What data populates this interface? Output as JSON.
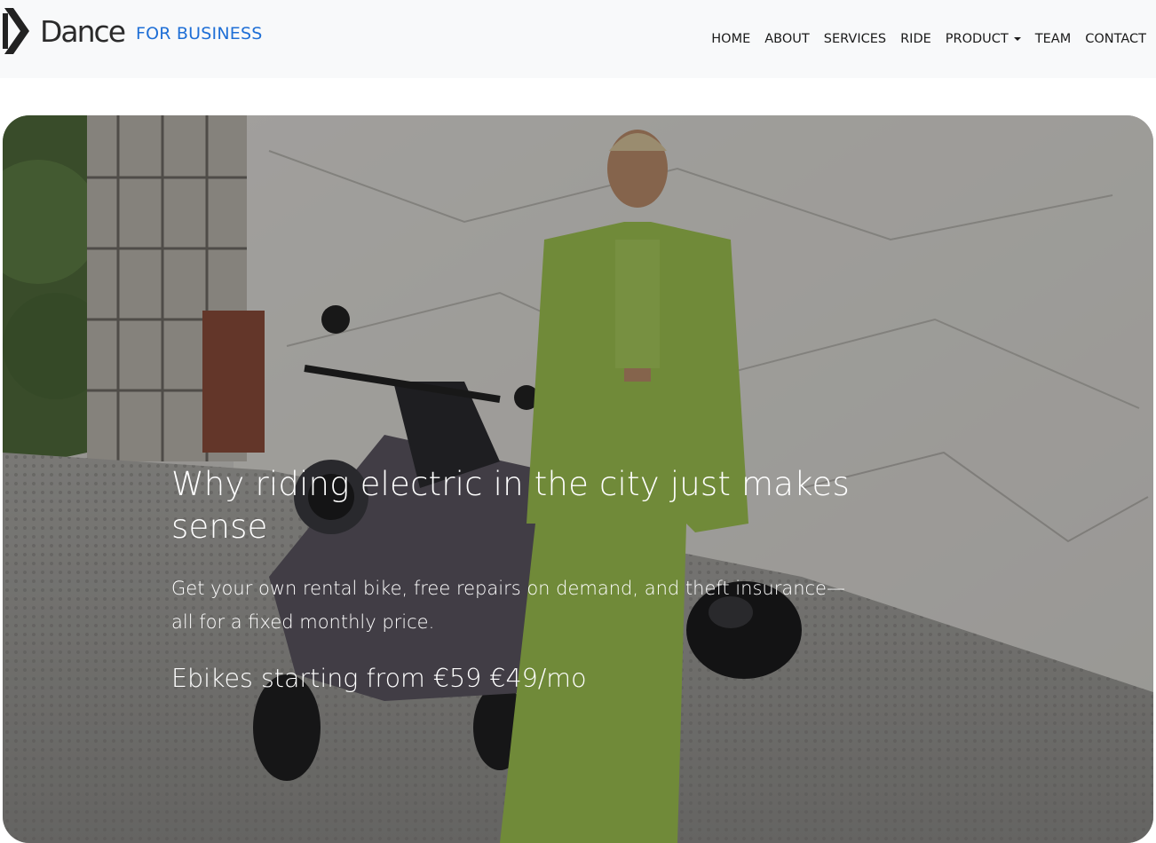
{
  "brand": {
    "name": "Dance",
    "sub": "FOR BUSINESS"
  },
  "nav": {
    "items": [
      {
        "label": "HOME"
      },
      {
        "label": "ABOUT"
      },
      {
        "label": "SERVICES"
      },
      {
        "label": "RIDE"
      },
      {
        "label": "PRODUCT"
      },
      {
        "label": "TEAM"
      },
      {
        "label": "CONTACT"
      }
    ]
  },
  "hero": {
    "title": "Why riding electric in the city just makes sense",
    "description": "Get your own rental bike, free repairs on demand, and theft insurance—all for a fixed monthly price.",
    "price": "Ebikes starting from €59 €49/mo",
    "image_alt": "Woman in green suit standing next to an electric scooter"
  },
  "colors": {
    "nav_bg": "#f8f9fa",
    "brand_accent": "#1f6fd6",
    "hero_text": "#ffffff"
  }
}
